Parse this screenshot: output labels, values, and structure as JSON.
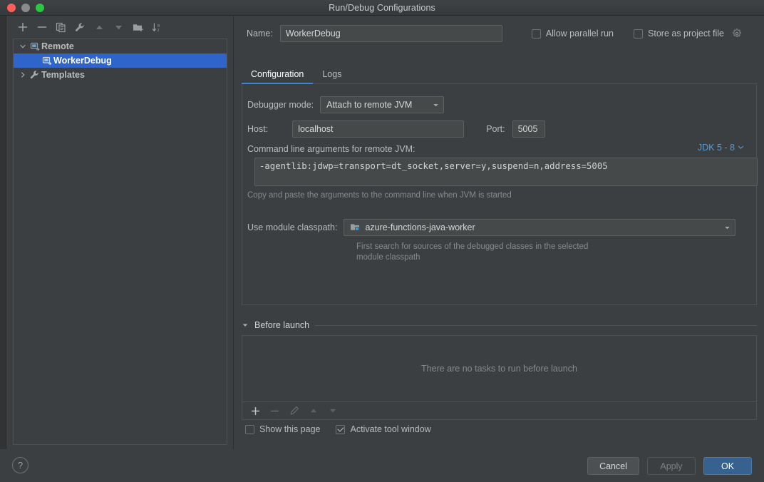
{
  "window": {
    "title": "Run/Debug Configurations",
    "traffic_lights": [
      "close-red",
      "minimize-gray",
      "zoom-green"
    ]
  },
  "sidebar": {
    "toolbar": [
      {
        "name": "add-configuration",
        "icon": "plus-icon"
      },
      {
        "name": "remove-configuration",
        "icon": "minus-icon"
      },
      {
        "name": "copy-configuration",
        "icon": "copy-icon"
      },
      {
        "name": "edit-templates",
        "icon": "wrench-icon"
      },
      {
        "name": "move-up",
        "icon": "arrow-up-icon"
      },
      {
        "name": "move-down",
        "icon": "arrow-down-icon"
      },
      {
        "name": "new-folder",
        "icon": "folder-add-icon"
      },
      {
        "name": "sort-alphabetically",
        "icon": "sort-az-icon"
      }
    ],
    "tree": [
      {
        "label": "Remote",
        "level": 0,
        "expanded": true,
        "selected": false,
        "icon": "remote-debug-icon",
        "twisty": "chevron-down-icon"
      },
      {
        "label": "WorkerDebug",
        "level": 1,
        "expanded": false,
        "selected": true,
        "icon": "remote-debug-icon",
        "twisty": "none"
      },
      {
        "label": "Templates",
        "level": 0,
        "expanded": false,
        "selected": false,
        "icon": "wrench-icon",
        "twisty": "chevron-right-icon"
      }
    ]
  },
  "header": {
    "name_label": "Name:",
    "name_value": "WorkerDebug",
    "name_placeholder": "",
    "allow_parallel_run": {
      "label": "Allow parallel run",
      "checked": false
    },
    "store_as_project_file": {
      "label": "Store as project file",
      "checked": false,
      "gear_icon": "gear-dropdown-icon"
    }
  },
  "tabs": [
    {
      "label": "Configuration",
      "active": true
    },
    {
      "label": "Logs",
      "active": false
    }
  ],
  "configuration": {
    "debugger_mode_label": "Debugger mode:",
    "debugger_mode_value": "Attach to remote JVM",
    "host_label": "Host:",
    "host_value": "localhost",
    "port_label": "Port:",
    "port_value": "5005",
    "args_label": "Command line arguments for remote JVM:",
    "jdk_selector": "JDK 5 - 8",
    "args_value": "-agentlib:jdwp=transport=dt_socket,server=y,suspend=n,address=5005",
    "args_hint": "Copy and paste the arguments to the command line when JVM is started",
    "module_label": "Use module classpath:",
    "module_value": "azure-functions-java-worker",
    "module_icon": "module-icon",
    "module_hint_line1": "First search for sources of the debugged classes in the selected",
    "module_hint_line2": "module classpath"
  },
  "before_launch": {
    "title": "Before launch",
    "collapse_icon": "triangle-down-icon",
    "empty_text": "There are no tasks to run before launch",
    "toolbar": [
      {
        "name": "add-task",
        "icon": "plus-icon",
        "enabled": true
      },
      {
        "name": "remove-task",
        "icon": "minus-icon",
        "enabled": false
      },
      {
        "name": "edit-task",
        "icon": "pencil-icon",
        "enabled": false
      },
      {
        "name": "task-move-up",
        "icon": "arrow-up-icon",
        "enabled": false
      },
      {
        "name": "task-move-down",
        "icon": "arrow-down-icon",
        "enabled": false
      }
    ],
    "show_this_page": {
      "label": "Show this page",
      "checked": false
    },
    "activate_tool_window": {
      "label": "Activate tool window",
      "checked": true
    }
  },
  "footer": {
    "help_label": "?",
    "cancel_label": "Cancel",
    "apply_label": "Apply",
    "apply_enabled": false,
    "ok_label": "OK"
  },
  "colors": {
    "background": "#3c3f41",
    "selection_blue": "#2f65ca",
    "accent_link": "#5b9bd5",
    "tab_underline": "#3d85d4",
    "primary_button": "#37618e",
    "field_background": "#45494a",
    "border": "#4f5254",
    "text": "#bbbbbb",
    "muted_text": "#878a8c"
  }
}
